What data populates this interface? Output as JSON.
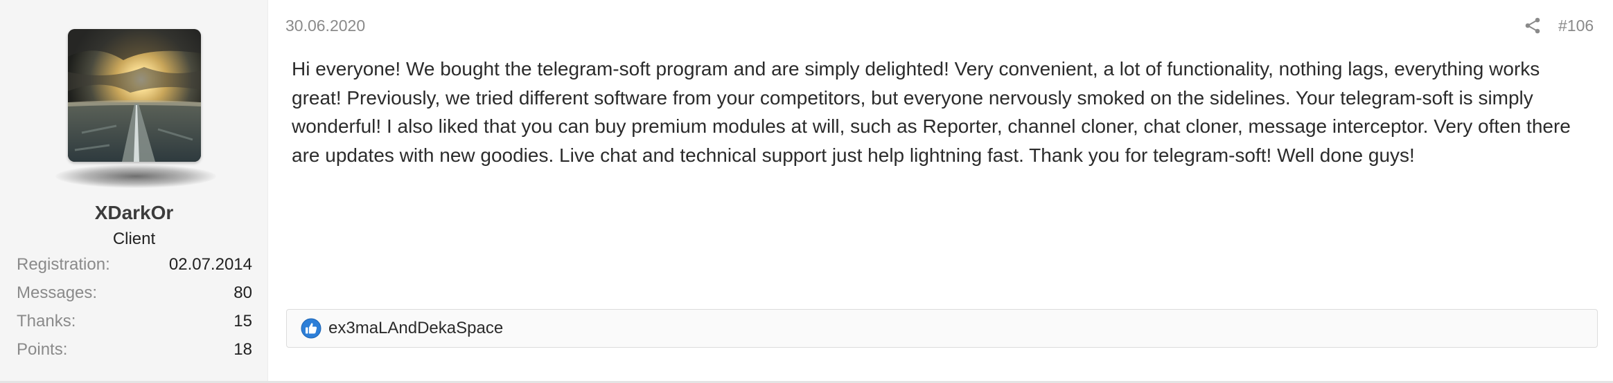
{
  "user": {
    "avatar_icon": "avatar-landscape-sunset",
    "username": "XDarkOr",
    "title": "Client",
    "stats": [
      {
        "label": "Registration:",
        "value": "02.07.2014"
      },
      {
        "label": "Messages:",
        "value": "80"
      },
      {
        "label": "Thanks:",
        "value": "15"
      },
      {
        "label": "Points:",
        "value": "18"
      }
    ]
  },
  "post": {
    "date": "30.06.2020",
    "share_icon": "share-icon",
    "number": "#106",
    "body": "Hi everyone! We bought the telegram-soft program and are simply delighted! Very convenient, a lot of functionality, nothing lags, everything works great! Previously, we tried different software from your competitors, but everyone nervously smoked on the sidelines. Your telegram-soft is simply wonderful! I also liked that you can buy premium modules at will, such as Reporter, channel cloner, chat cloner, message interceptor. Very often there are updates with new goodies. Live chat and technical support just help lightning fast. Thank you for telegram-soft! Well done guys!"
  },
  "reactions": {
    "icon": "thumbs-up-icon",
    "users": "ex3maLAndDekaSpace"
  },
  "colors": {
    "sidebar_bg": "#f5f5f5",
    "muted_text": "#8a8a8a",
    "like_blue": "#2d7fd8"
  }
}
